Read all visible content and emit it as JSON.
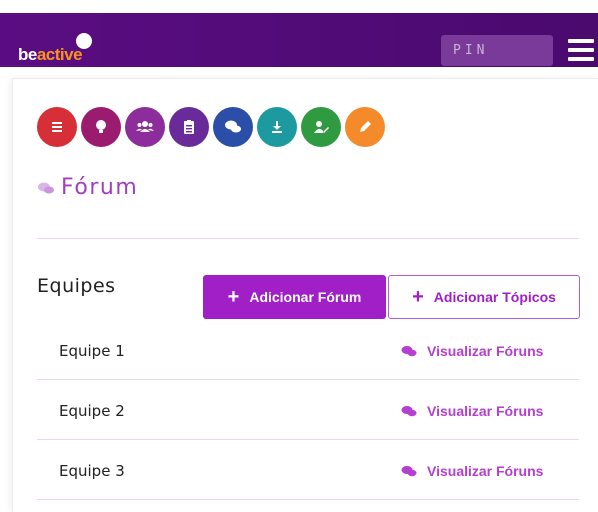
{
  "header": {
    "logo_be": "be",
    "logo_active": "active",
    "pin_label": "PIN",
    "menu_icon": "hamburger-menu-icon"
  },
  "toolbar_icons": [
    {
      "name": "list-icon",
      "color": "#d62f38"
    },
    {
      "name": "lightbulb-icon",
      "color": "#9b1c6e"
    },
    {
      "name": "users-icon",
      "color": "#8d2d9c"
    },
    {
      "name": "clipboard-icon",
      "color": "#6a2b9a"
    },
    {
      "name": "chat-icon",
      "color": "#2b4fa8"
    },
    {
      "name": "download-icon",
      "color": "#1d9aa0"
    },
    {
      "name": "user-edit-icon",
      "color": "#2f9a3f"
    },
    {
      "name": "pen-icon",
      "color": "#f58a2a"
    }
  ],
  "page": {
    "title": "Fórum"
  },
  "section": {
    "label": "Equipes",
    "add_forum_button": "Adicionar Fórum",
    "add_topics_button": "Adicionar Tópicos"
  },
  "teams": [
    {
      "name": "Equipe 1",
      "link": "Visualizar Fóruns"
    },
    {
      "name": "Equipe 2",
      "link": "Visualizar Fóruns"
    },
    {
      "name": "Equipe 3",
      "link": "Visualizar Fóruns"
    }
  ]
}
